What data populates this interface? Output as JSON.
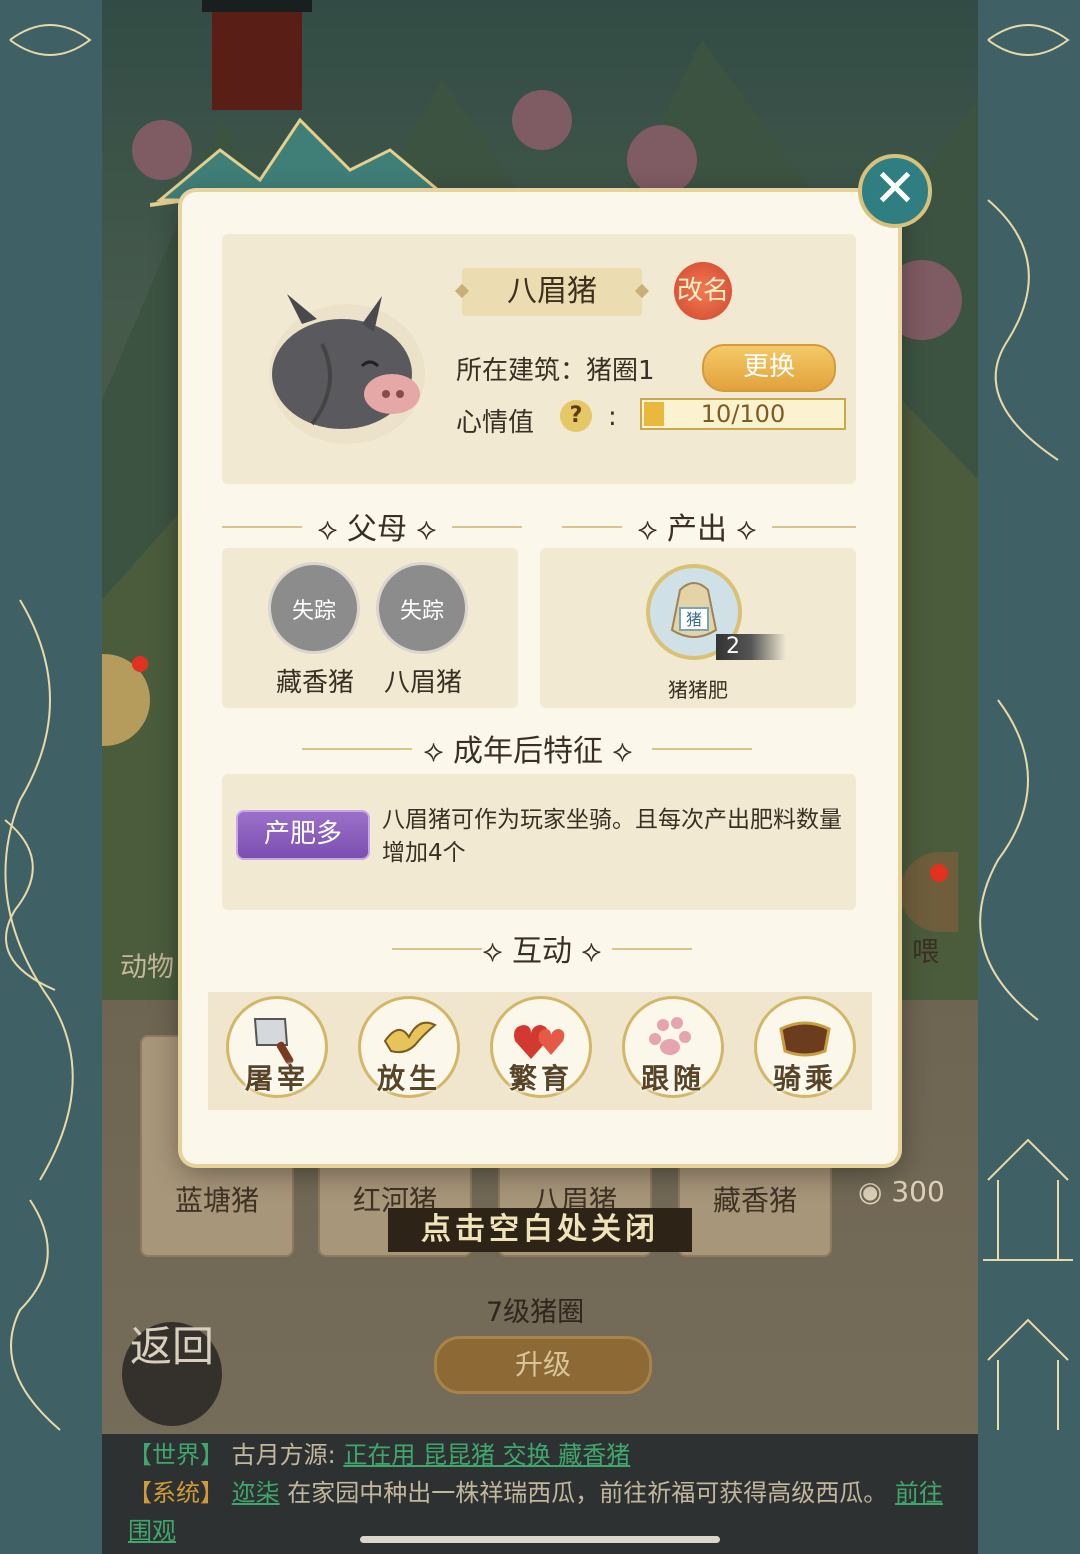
{
  "modal": {
    "pig_name": "八眉猪",
    "rename_label": "改名",
    "building_label": "所在建筑：猪圈1",
    "change_label": "更换",
    "mood_label": "心情值",
    "mood_help": "?",
    "mood_colon": ":",
    "mood_text": "10/100",
    "mood_fraction": 0.1,
    "parents_title": "父母",
    "output_title": "产出",
    "parents": [
      {
        "name": "藏香猪",
        "status": "失踪"
      },
      {
        "name": "八眉猪",
        "status": "失踪"
      }
    ],
    "output": {
      "name": "猪猪肥",
      "count": "2",
      "icon_glyph": "猪"
    },
    "trait_title": "成年后特征",
    "trait_tag": "产肥多",
    "trait_desc": "八眉猪可作为玩家坐骑。且每次产出肥料数量增加4个",
    "interact_title": "互动",
    "actions": [
      {
        "label": "屠宰",
        "icon": "cleaver-icon"
      },
      {
        "label": "放生",
        "icon": "bird-icon"
      },
      {
        "label": "繁育",
        "icon": "hearts-icon"
      },
      {
        "label": "跟随",
        "icon": "paw-icon"
      },
      {
        "label": "骑乘",
        "icon": "saddle-icon"
      }
    ]
  },
  "background": {
    "close_hint": "点击空白处关闭",
    "cards": [
      "蓝塘猪",
      "红河猪",
      "八眉猪",
      "藏香猪"
    ],
    "coins": "300",
    "pen_level": "7级猪圈",
    "upgrade_label": "升级",
    "return_label": "返回",
    "animal_label": "动物",
    "feed_label": "喂"
  },
  "chat": {
    "line1_tag": "【世界】",
    "line1_name": "古月方源:",
    "line1_link": "正在用 昆昆猪 交换 藏香猪",
    "line2_tag": "【系统】",
    "line2_name": "迩柒",
    "line2_text": "在家园中种出一株祥瑞西瓜，前往祈福可获得高级西瓜。",
    "line2_link": "前往围观"
  },
  "colors": {
    "accent_gold": "#e2a23c",
    "trait_purple": "#7b4fb0",
    "rename_red": "#d24630",
    "panel_bg": "#fbf7ea",
    "chat_green": "#3fa66d"
  }
}
